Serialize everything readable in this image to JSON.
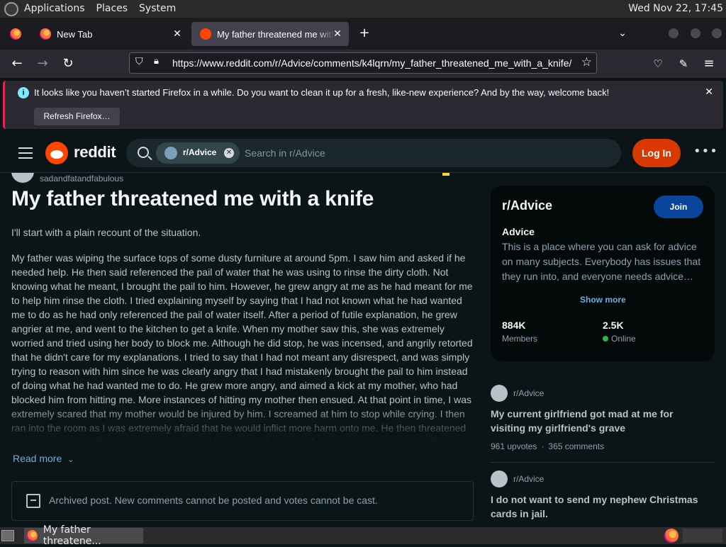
{
  "top_panel": {
    "menus": [
      "Applications",
      "Places",
      "System"
    ],
    "clock": "Wed Nov 22, 17:45"
  },
  "browser": {
    "tabs": [
      {
        "title": "New Tab"
      },
      {
        "title": "My father threatened me with a knife"
      }
    ],
    "url": "https://www.reddit.com/r/Advice/comments/k4lqrn/my_father_threatened_me_with_a_knife/",
    "notification": {
      "message": "It looks like you haven’t started Firefox in a while. Do you want to clean it up for a fresh, like-new experience? And by the way, welcome back!",
      "button": "Refresh Firefox…"
    }
  },
  "reddit": {
    "wordmark": "reddit",
    "search_chip": "r/Advice",
    "search_placeholder": "Search in r/Advice",
    "login": "Log In"
  },
  "post": {
    "author": "sadandfatandfabulous",
    "title": "My father threatened me with a knife",
    "intro": "I'll start with a plain recount of the situation.",
    "body": "My father was wiping the surface tops of some dusty furniture at around 5pm. I saw him and asked if he needed help. He then said referenced the pail of water that he was using to rinse the dirty cloth. Not knowing what he meant, I brought the pail to him. However, he grew angry at me as he had meant for me to help him rinse the cloth. I tried explaining myself by saying that I had not known what he had wanted me to do as he had only referenced the pail of water itself. After a period of futile explanation, he grew angrier at me, and went to the kitchen to get a knife. When my mother saw this, she was extremely worried and tried using her body to block me. Although he did stop, he was incensed, and angrily retorted that he didn't care for my explanations. I tried to say that I had not meant any disrespect, and was simply trying to reason with him since he was clearly angry that I had mistakenly brought the pail to him instead of doing what he had wanted me to do. He grew more angry, and aimed a kick at my mother, who had blocked him from hitting me. More instances of hitting my mother then ensued. At that point in time, I was extremely scared that my mother would be injured by him. I screamed at him to stop while crying. I then ran into the room as I was extremely afraid that he would inflict more harm onto me. He then threatened divorce with my mother, and said that it would be my fault because of what a bad son I was. He then",
    "read_more": "Read more",
    "archived": "Archived post. New comments cannot be posted and votes cannot be cast."
  },
  "sidebar": {
    "sub_name": "r/Advice",
    "join": "Join",
    "desc_title": "Advice",
    "description": "This is a place where you can ask for advice on many subjects. Everybody has issues that they run into, and everyone needs advice…",
    "show_more": "Show more",
    "members_count": "884K",
    "members_label": "Members",
    "online_count": "2.5K",
    "online_label": "Online"
  },
  "related": [
    {
      "subreddit": "r/Advice",
      "title": "My current girlfriend got mad at me for visiting my girlfriend's grave",
      "upvotes": "961 upvotes",
      "separator": "·",
      "comments": "365 comments"
    },
    {
      "subreddit": "r/Advice",
      "title": "I do not want to send my nephew Christmas cards in jail."
    }
  ],
  "taskbar": {
    "window_title": "My father threatene..."
  }
}
